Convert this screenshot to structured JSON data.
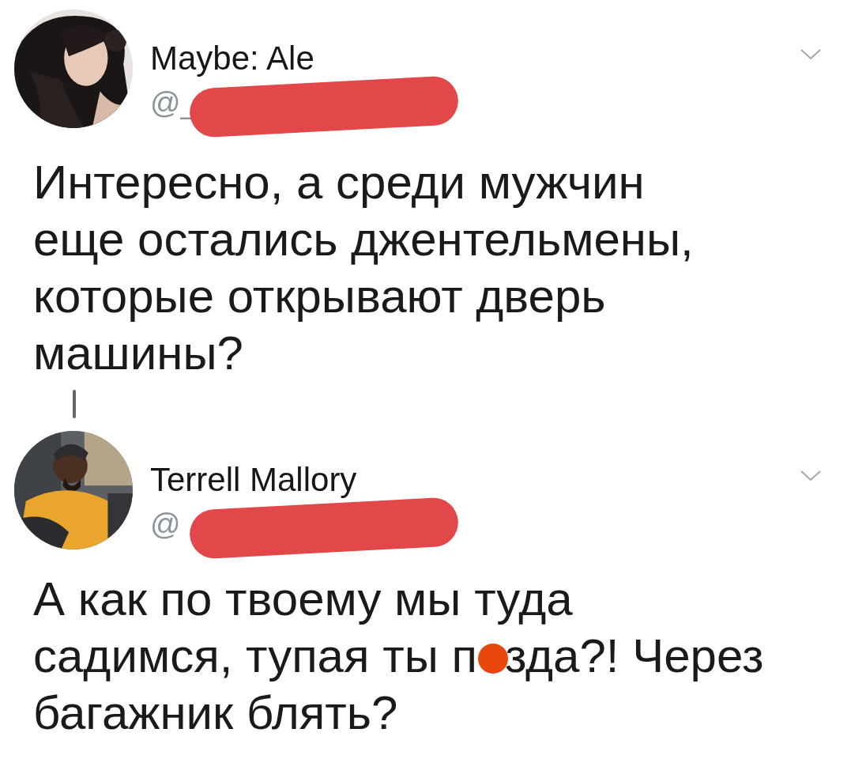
{
  "tweets": [
    {
      "author": "Maybe: Ale",
      "handle": "@_",
      "avatar": {
        "kind": "picture"
      },
      "lines": [
        [
          "Интересно, а среди мужчин"
        ],
        [
          "еще остались джентельмены,"
        ],
        [
          "которые открывают дверь"
        ],
        [
          "машины?"
        ]
      ]
    },
    {
      "author": "Terrell Mallory",
      "handle": "@",
      "avatar": {
        "kind": "picture"
      },
      "lines": [
        [
          "А как по твоему мы туда"
        ],
        [
          "садимся, тупая ты п",
          "зда?! Через"
        ],
        [
          "багажник блять?"
        ]
      ]
    }
  ]
}
